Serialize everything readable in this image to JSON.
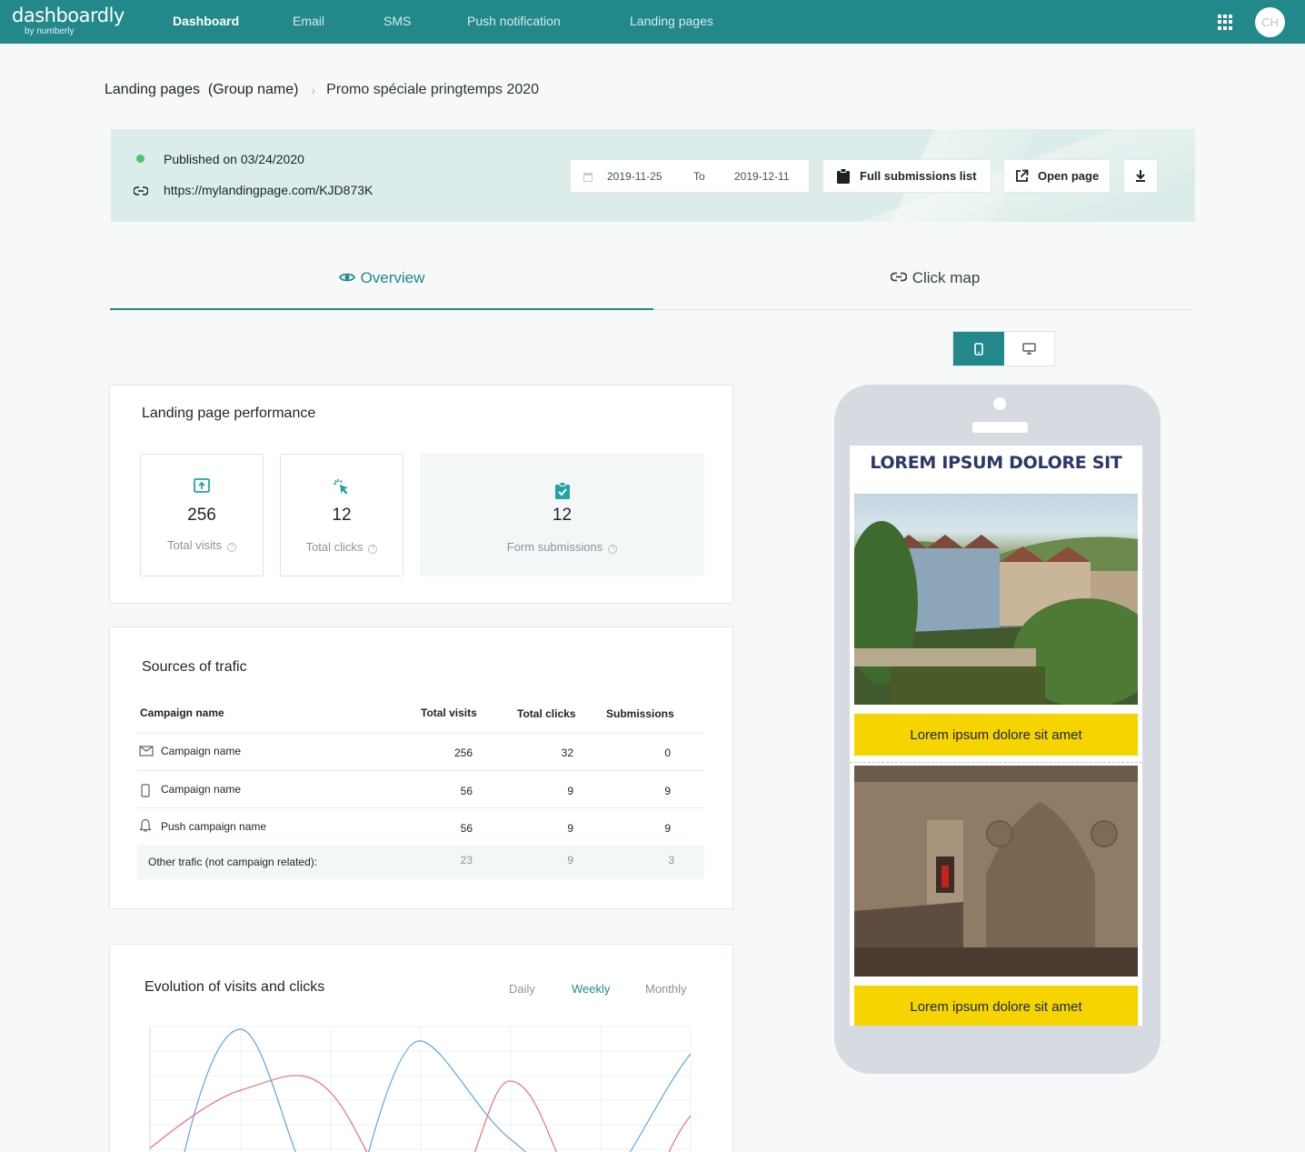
{
  "brand": {
    "name": "dashboardly",
    "tagline": "by numberly"
  },
  "nav": {
    "items": [
      {
        "label": "Dashboard",
        "active": true
      },
      {
        "label": "Email"
      },
      {
        "label": "SMS"
      },
      {
        "label": "Push notification"
      },
      {
        "label": "Landing pages"
      }
    ],
    "avatar_initials": "CH",
    "icons": [
      "apps-grid-icon"
    ]
  },
  "breadcrumb": {
    "parent": "Landing pages  (Group name)",
    "current": "Promo spéciale pringtemps 2020"
  },
  "header": {
    "published": "Published on 03/24/2020",
    "url": "https://mylandingpage.com/KJD873K",
    "date_from": "2019-11-25",
    "date_to_label": "To",
    "date_to": "2019-12-11",
    "submissions_button": "Full submissions list",
    "open_button": "Open page",
    "status_color": "#4cc36b"
  },
  "tabs": {
    "overview": "Overview",
    "clickmap": "Click map"
  },
  "performance": {
    "title": "Landing page performance",
    "visits": {
      "value": "256",
      "label": "Total visits"
    },
    "clicks": {
      "value": "12",
      "label": "Total clicks"
    },
    "forms": {
      "value": "12",
      "label": "Form submissions"
    }
  },
  "sources": {
    "title": "Sources of trafic",
    "columns": [
      "Campaign name",
      "Total visits",
      "Total clicks",
      "Submissions"
    ],
    "rows": [
      {
        "icon": "email-icon",
        "name": "Campaign name",
        "visits": "256",
        "clicks": "32",
        "subs": "0"
      },
      {
        "icon": "mobile-icon",
        "name": "Campaign name",
        "visits": "56",
        "clicks": "9",
        "subs": "9"
      },
      {
        "icon": "bell-icon",
        "name": "Push campaign name",
        "visits": "56",
        "clicks": "9",
        "subs": "9"
      }
    ],
    "other": {
      "name": "Other trafic (not campaign related):",
      "visits": "23",
      "clicks": "9",
      "subs": "3"
    }
  },
  "evolution": {
    "title": "Evolution of visits and clicks",
    "periods": [
      "Daily",
      "Weekly",
      "Monthly"
    ],
    "selected": "Weekly"
  },
  "preview": {
    "title": "LOREM IPSUM DOLORE SIT",
    "cta1": "Lorem ipsum dolore sit amet",
    "cta2": "Lorem ipsum dolore sit amet"
  },
  "colors": {
    "brand": "#22888a",
    "cta": "#f5d400",
    "visits_line": "#5aa6e0",
    "clicks_line": "#e8708a"
  }
}
